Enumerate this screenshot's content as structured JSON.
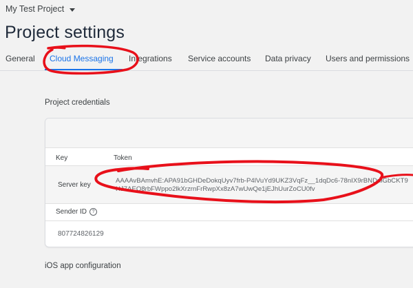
{
  "project": {
    "name": "My Test Project"
  },
  "page": {
    "title": "Project settings"
  },
  "tabs": [
    {
      "label": "General"
    },
    {
      "label": "Cloud Messaging"
    },
    {
      "label": "Integrations"
    },
    {
      "label": "Service accounts"
    },
    {
      "label": "Data privacy"
    },
    {
      "label": "Users and permissions"
    }
  ],
  "active_tab": "Cloud Messaging",
  "credentials": {
    "section_title": "Project credentials",
    "columns": {
      "key": "Key",
      "token": "Token"
    },
    "server_key": {
      "label": "Server key",
      "token_line1": "AAAAvBAmvhE:APA91bGHDeDokqUyv7frb-P4lVuYd9UKZ3VqFz__1dqDc6-78nIX9rBNDniGbCKT9",
      "token_line2": "HJ7AEQ8rbFWppo2lkXrzrnFrRwpXx8zA7wUwQe1jEJhUurZoCU0fv"
    },
    "sender_id": {
      "label": "Sender ID",
      "help_icon": "help-circle-icon",
      "value": "807724826129"
    }
  },
  "ios_section": {
    "title": "iOS app configuration"
  },
  "colors": {
    "accent": "#1a73e8",
    "annotation": "#e8101a"
  }
}
